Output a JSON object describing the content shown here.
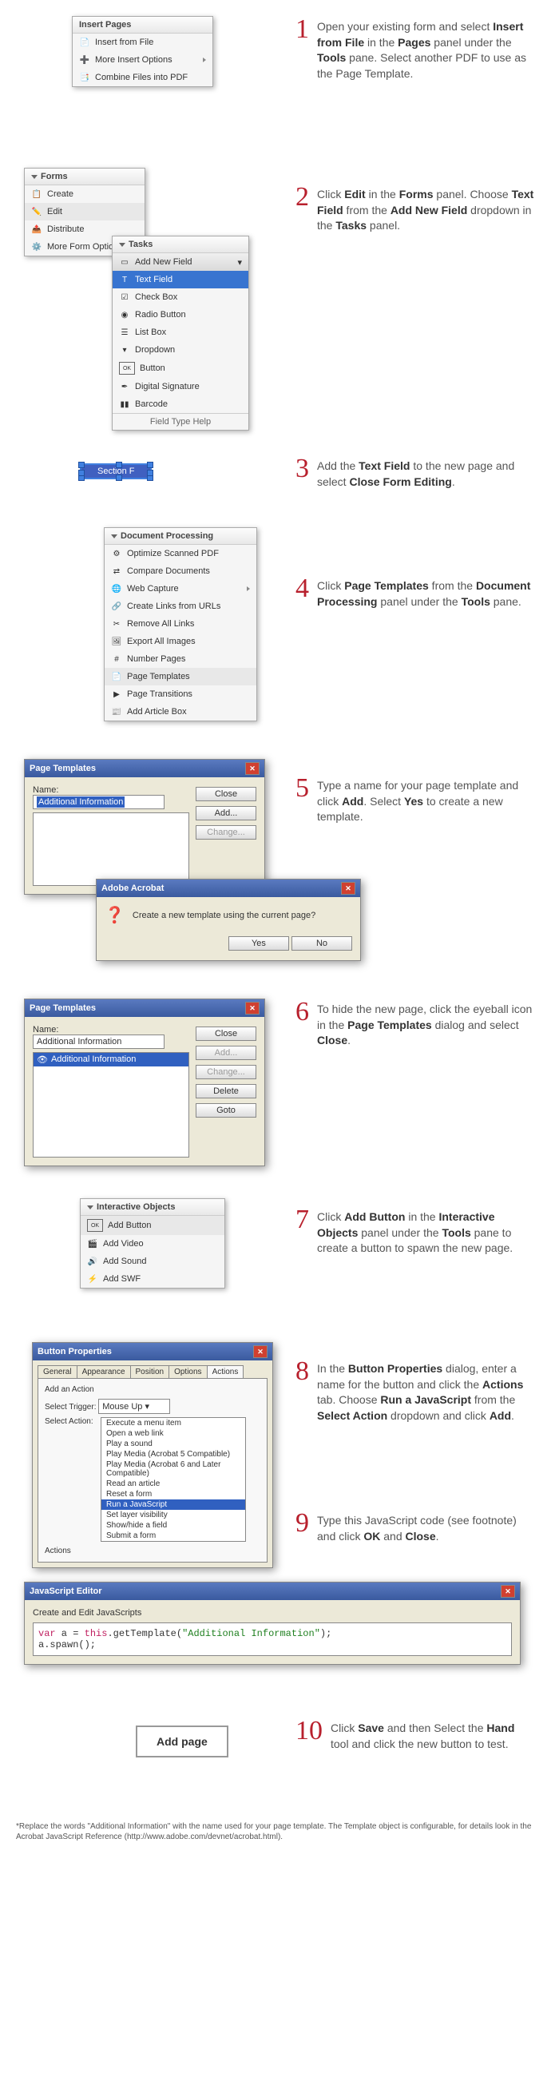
{
  "s1": {
    "num": "1",
    "text": "Open your existing form and select <b>Insert from File</b> in the <b>Pages</b> panel under the <b>Tools</b> pane. Select another PDF to use as the Page Template."
  },
  "s2": {
    "num": "2",
    "text": "Click <b>Edit</b> in the <b>Forms</b> panel. Choose <b>Text Field</b> from the <b>Add New Field</b> dropdown in the <b>Tasks</b> panel."
  },
  "s3": {
    "num": "3",
    "text": "Add the <b>Text Field</b> to the new page and select <b>Close Form Editing</b>."
  },
  "s4": {
    "num": "4",
    "text": "Click <b>Page Templates</b> from the <b>Document Processing</b> panel under the <b>Tools</b> pane."
  },
  "s5": {
    "num": "5",
    "text": "Type a name for your page template and click <b>Add</b>. Select <b>Yes</b> to create a new template."
  },
  "s6": {
    "num": "6",
    "text": "To hide the new page, click the eyeball icon in the <b>Page Templates</b> dialog and select <b>Close</b>."
  },
  "s7": {
    "num": "7",
    "text": "Click <b>Add Button</b> in the <b>Interactive Objects</b> panel under the <b>Tools</b> pane to create a button to spawn the new page."
  },
  "s8": {
    "num": "8",
    "text": "In the <b>Button Properties</b> dialog, enter a name for the button and click the <b>Actions</b> tab. Choose <b>Run a JavaScript</b> from the <b>Select Action</b> dropdown and click <b>Add</b>."
  },
  "s9": {
    "num": "9",
    "text": "Type this JavaScript code (see footnote) and click <b>OK</b> and <b>Close</b>."
  },
  "s10": {
    "num": "10",
    "text": "Click <b>Save</b> and then Select the <b>Hand</b> tool and click the new button to test."
  },
  "p1": {
    "title": "Insert Pages",
    "items": [
      "Insert from File",
      "More Insert Options",
      "Combine Files into PDF"
    ]
  },
  "p2": {
    "title": "Forms",
    "items": [
      "Create",
      "Edit",
      "Distribute",
      "More Form Options"
    ]
  },
  "p3": {
    "title": "Tasks",
    "header": "Add New Field",
    "items": [
      "Text Field",
      "Check Box",
      "Radio Button",
      "List Box",
      "Dropdown",
      "Button",
      "Digital Signature",
      "Barcode"
    ],
    "footer": "Field Type Help"
  },
  "tf": {
    "label": "Section F"
  },
  "p4": {
    "title": "Document Processing",
    "items": [
      "Optimize Scanned PDF",
      "Compare Documents",
      "Web Capture",
      "Create Links from URLs",
      "Remove All Links",
      "Export All Images",
      "Number Pages",
      "Page Templates",
      "Page Transitions",
      "Add Article Box"
    ]
  },
  "pt1": {
    "title": "Page Templates",
    "nameLbl": "Name:",
    "nameVal": "Additional Information",
    "btns": [
      "Close",
      "Add...",
      "Change..."
    ]
  },
  "conf": {
    "title": "Adobe Acrobat",
    "msg": "Create a new template using the current page?",
    "yes": "Yes",
    "no": "No"
  },
  "pt2": {
    "title": "Page Templates",
    "nameLbl": "Name:",
    "nameVal": "Additional Information",
    "listItem": "Additional Information",
    "btns": [
      "Close",
      "Add...",
      "Change...",
      "Delete",
      "Goto"
    ]
  },
  "p5": {
    "title": "Interactive Objects",
    "items": [
      "Add Button",
      "Add Video",
      "Add Sound",
      "Add SWF"
    ]
  },
  "bp": {
    "title": "Button Properties",
    "tabs": [
      "General",
      "Appearance",
      "Position",
      "Options",
      "Actions"
    ],
    "addAction": "Add an Action",
    "selTrig": "Select Trigger:",
    "trigVal": "Mouse Up",
    "selAct": "Select Action:",
    "actions": "Actions",
    "opts": [
      "Execute a menu item",
      "Open a web link",
      "Play a sound",
      "Play Media (Acrobat 5 Compatible)",
      "Play Media (Acrobat 6 and Later Compatible)",
      "Read an article",
      "Reset a form",
      "Run a JavaScript",
      "Set layer visibility",
      "Show/hide a field",
      "Submit a form"
    ]
  },
  "js": {
    "title": "JavaScript Editor",
    "label": "Create and Edit JavaScripts",
    "code": "var a = this.getTemplate(\"Additional Information\");\na.spawn();"
  },
  "addBtn": "Add page",
  "foot": "*Replace the words \"Additional Information\" with the name used for your page template. The Template object is configurable, for details look in the Acrobat JavaScript Reference (http://www.adobe.com/devnet/acrobat.html)."
}
